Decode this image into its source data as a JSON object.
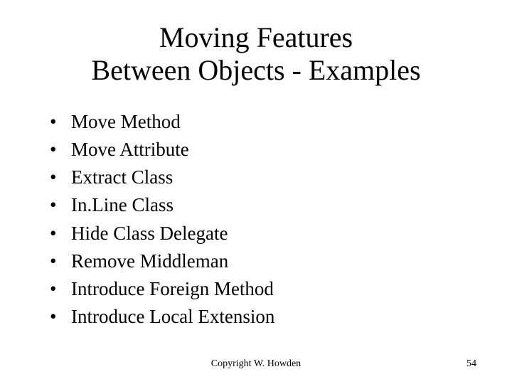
{
  "title_line1": "Moving Features",
  "title_line2": "Between Objects - Examples",
  "bullets": {
    "0": "Move Method",
    "1": "Move Attribute",
    "2": "Extract Class",
    "3": "In.Line Class",
    "4": "Hide Class Delegate",
    "5": "Remove Middleman",
    "6": "Introduce Foreign Method",
    "7": "Introduce Local Extension"
  },
  "footer": "Copyright W. Howden",
  "page_number": "54"
}
